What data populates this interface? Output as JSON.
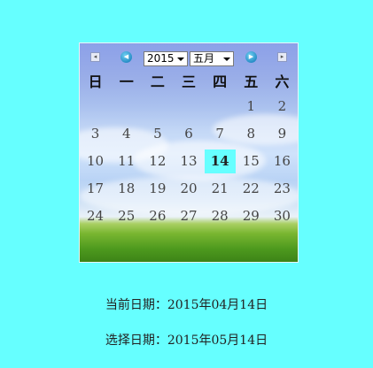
{
  "calendar": {
    "year_value": "2015",
    "month_value": "五月",
    "weekdays": [
      "日",
      "一",
      "二",
      "三",
      "四",
      "五",
      "六"
    ],
    "weeks": [
      [
        "",
        "",
        "",
        "",
        "",
        "1",
        "2"
      ],
      [
        "3",
        "4",
        "5",
        "6",
        "7",
        "8",
        "9"
      ],
      [
        "10",
        "11",
        "12",
        "13",
        "14",
        "15",
        "16"
      ],
      [
        "17",
        "18",
        "19",
        "20",
        "21",
        "22",
        "23"
      ],
      [
        "24",
        "25",
        "26",
        "27",
        "28",
        "29",
        "30"
      ]
    ],
    "selected_day": "14",
    "selected_color": "#66ffff"
  },
  "info": {
    "current_date": "当前日期：2015年04月14日",
    "selected_date": "选择日期：2015年05月14日"
  }
}
